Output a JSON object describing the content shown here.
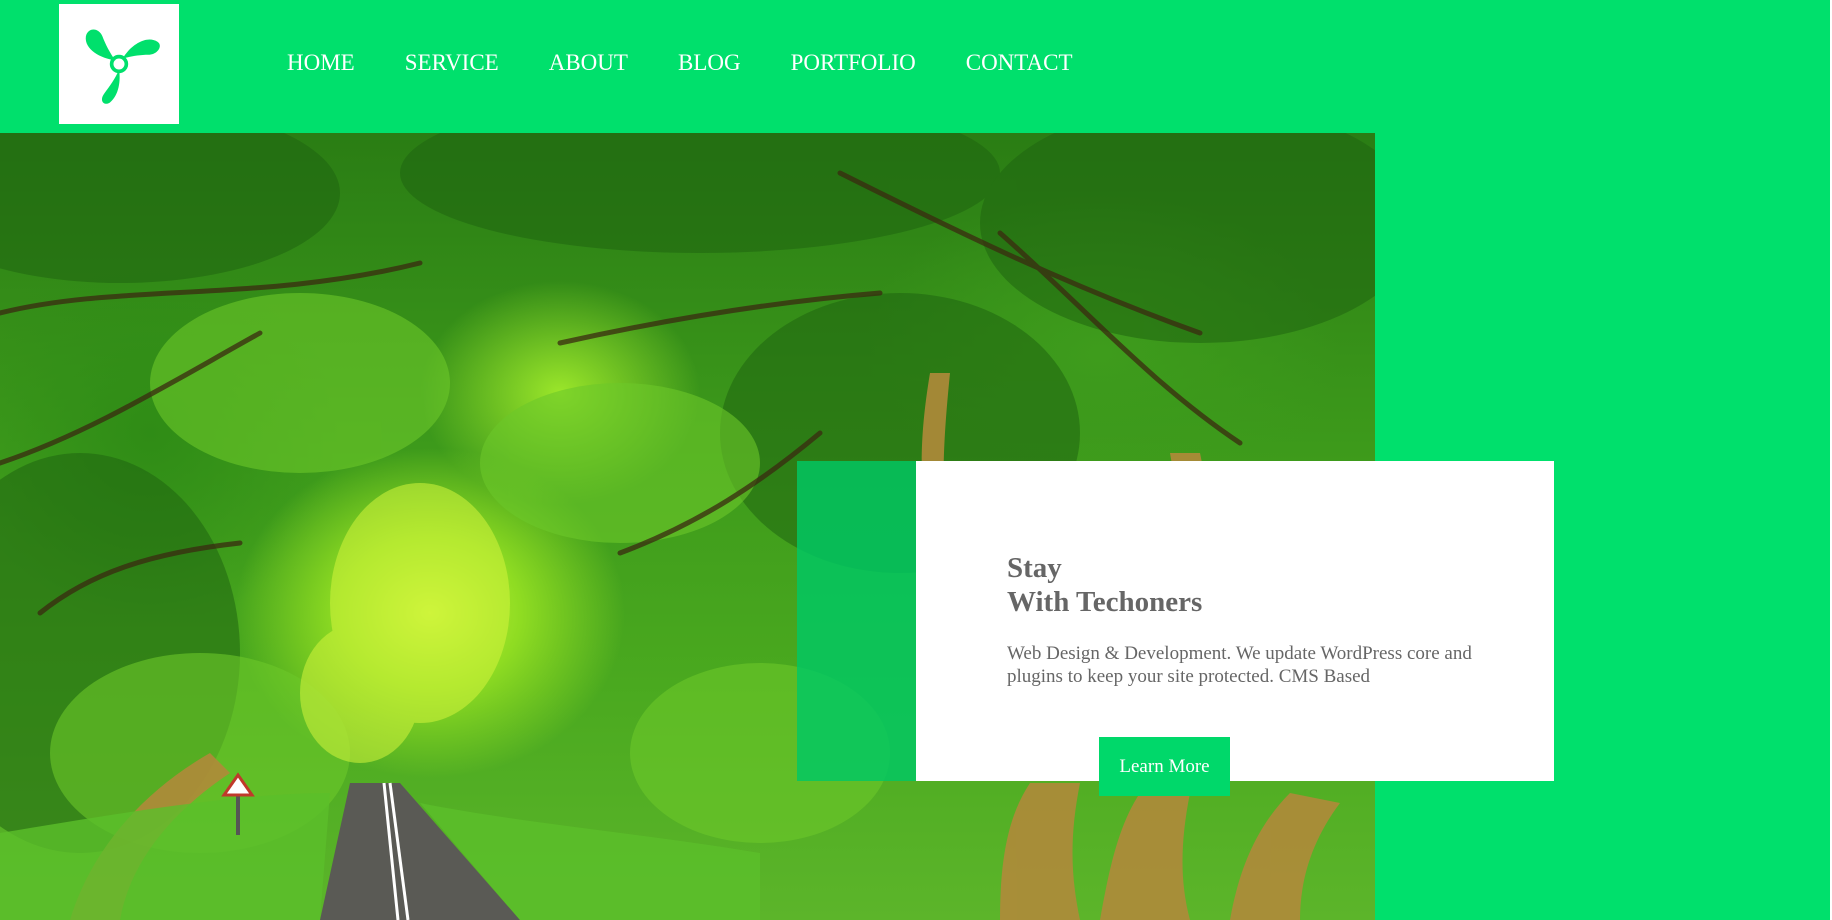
{
  "nav": {
    "items": [
      {
        "label": "HOME"
      },
      {
        "label": "SERVICE"
      },
      {
        "label": "ABOUT"
      },
      {
        "label": "BLOG"
      },
      {
        "label": "PORTFOLIO"
      },
      {
        "label": "CONTACT"
      }
    ]
  },
  "hero": {
    "title_line1": "Stay",
    "title_line2": "With Techoners",
    "description": "Web Design & Development. We update WordPress core and plugins to keep your site protected. CMS Based",
    "cta_label": "Learn More"
  },
  "colors": {
    "brand_green": "#00e06c",
    "button_green": "#00d86a",
    "text_gray": "#666666",
    "white": "#ffffff"
  },
  "icons": {
    "logo": "tri-leaf-logo-icon"
  }
}
